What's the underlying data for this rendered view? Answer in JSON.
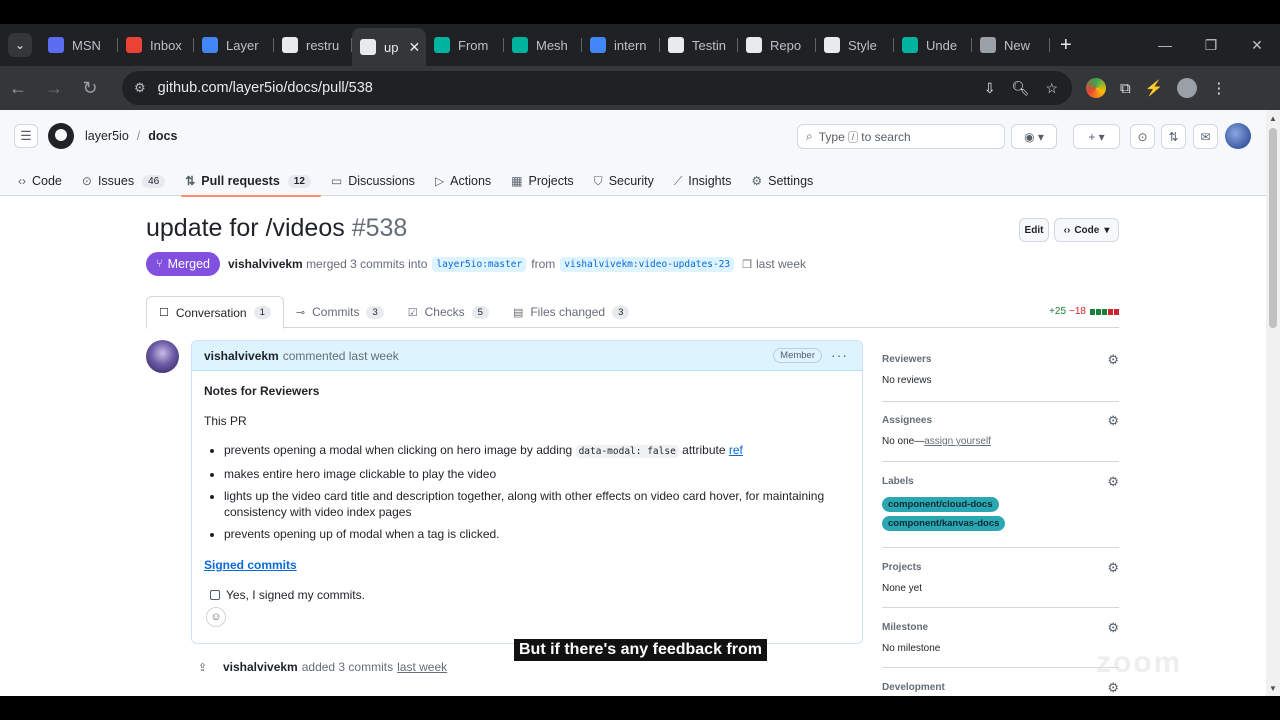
{
  "browser": {
    "tabs": [
      {
        "title": "MSN",
        "fav_color": "#5b6cf0",
        "fav": "icon-msn",
        "active": false
      },
      {
        "title": "Inbox",
        "fav_color": "#ea4335",
        "fav": "icon-gmail",
        "active": false
      },
      {
        "title": "Layer",
        "fav_color": "#4285f4",
        "fav": "icon-docs",
        "active": false
      },
      {
        "title": "restru",
        "fav_color": "#e8eaed",
        "fav": "icon-github",
        "active": false
      },
      {
        "title": "up",
        "fav_color": "#e8eaed",
        "fav": "icon-github",
        "active": true
      },
      {
        "title": "From",
        "fav_color": "#00b39f",
        "fav": "icon-layer5",
        "active": false
      },
      {
        "title": "Mesh",
        "fav_color": "#00b39f",
        "fav": "icon-meshery",
        "active": false
      },
      {
        "title": "intern",
        "fav_color": "#4285f4",
        "fav": "icon-google",
        "active": false
      },
      {
        "title": "Testin",
        "fav_color": "#e8eaed",
        "fav": "icon-github",
        "active": false
      },
      {
        "title": "Repo",
        "fav_color": "#e8eaed",
        "fav": "icon-github",
        "active": false
      },
      {
        "title": "Style",
        "fav_color": "#e8eaed",
        "fav": "icon-loading",
        "active": false
      },
      {
        "title": "Unde",
        "fav_color": "#00b39f",
        "fav": "icon-layer5",
        "active": false
      },
      {
        "title": "New",
        "fav_color": "#9aa0a6",
        "fav": "icon-globe",
        "active": false
      }
    ],
    "url": "github.com/layer5io/docs/pull/538"
  },
  "github": {
    "owner": "layer5io",
    "repo": "docs",
    "search_type": "Type",
    "search_key": "/",
    "search_rest": "to search",
    "nav": [
      {
        "label": "Code",
        "icon": "code-icon",
        "count": ""
      },
      {
        "label": "Issues",
        "icon": "issue-icon",
        "count": "46"
      },
      {
        "label": "Pull requests",
        "icon": "pull-request-icon",
        "count": "12",
        "selected": true
      },
      {
        "label": "Discussions",
        "icon": "discussion-icon",
        "count": ""
      },
      {
        "label": "Actions",
        "icon": "play-icon",
        "count": ""
      },
      {
        "label": "Projects",
        "icon": "table-icon",
        "count": ""
      },
      {
        "label": "Security",
        "icon": "shield-icon",
        "count": ""
      },
      {
        "label": "Insights",
        "icon": "graph-icon",
        "count": ""
      },
      {
        "label": "Settings",
        "icon": "gear-icon",
        "count": ""
      }
    ]
  },
  "pr": {
    "title": "update for /videos",
    "number": "#538",
    "edit_label": "Edit",
    "code_label": "Code",
    "state": "Merged",
    "author": "vishalvivekm",
    "merged_text": "merged 3 commits into",
    "base_branch": "layer5io:master",
    "from_text": "from",
    "head_branch": "vishalvivekm:video-updates-23",
    "time": "last week",
    "tabs": [
      {
        "label": "Conversation",
        "count": "1",
        "icon": "comment-icon",
        "active": true
      },
      {
        "label": "Commits",
        "count": "3",
        "icon": "commit-icon",
        "active": false
      },
      {
        "label": "Checks",
        "count": "5",
        "icon": "checklist-icon",
        "active": false
      },
      {
        "label": "Files changed",
        "count": "3",
        "icon": "file-diff-icon",
        "active": false
      }
    ],
    "additions": "+25",
    "deletions": "−18",
    "colors": {
      "merged": "#8250df",
      "add": "#1a7f37",
      "del": "#cf222e"
    }
  },
  "comment": {
    "author": "vishalvivekm",
    "meta": "commented last week",
    "role": "Member",
    "heading": "Notes for Reviewers",
    "intro": "This PR",
    "bullets": {
      "b1_pre": "prevents opening a modal when clicking on hero image by adding",
      "b1_code": "data-modal: false",
      "b1_post": "attribute",
      "b1_link": "ref",
      "b2": "makes entire hero image clickable to play the video",
      "b3": "lights up the video card title and description together, along with other effects on video card hover, for maintaining consistency with video index pages",
      "b4": "prevents opening up of modal when a tag is clicked."
    },
    "signed_heading": "Signed commits",
    "checkbox_label": "Yes, I signed my commits."
  },
  "timeline": {
    "author": "vishalvivekm",
    "action": "added 3 commits",
    "time": "last week"
  },
  "sidebar": {
    "reviewers_title": "Reviewers",
    "reviewers_value": "No reviews",
    "assignees_title": "Assignees",
    "assignees_value": "No one—",
    "assignees_link": "assign yourself",
    "labels_title": "Labels",
    "labels": [
      "component/cloud-docs",
      "component/kanvas-docs"
    ],
    "projects_title": "Projects",
    "projects_value": "None yet",
    "milestone_title": "Milestone",
    "milestone_value": "No milestone",
    "development_title": "Development"
  },
  "overlay": {
    "caption": "But if there's any feedback from",
    "watermark": "zoom"
  }
}
